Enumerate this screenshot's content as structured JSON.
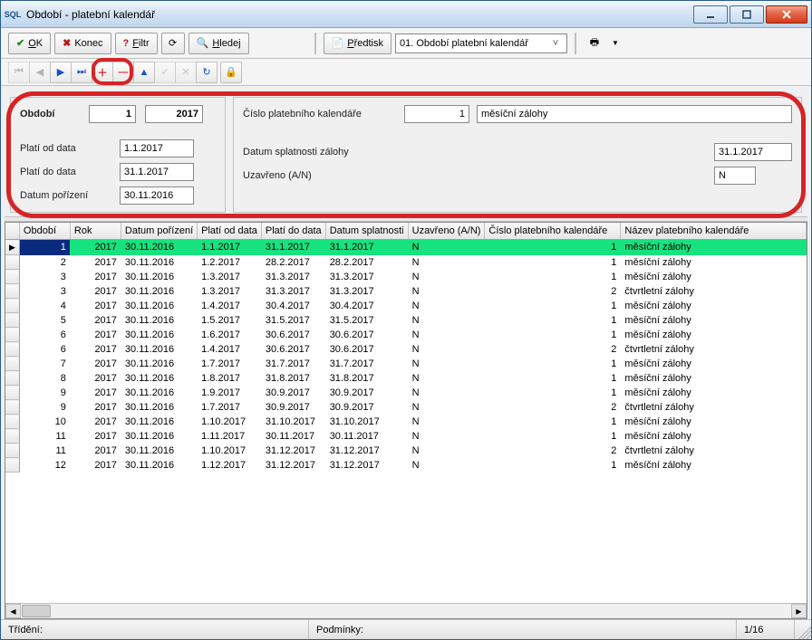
{
  "title": "Období - platební kalendář",
  "toolbar": {
    "ok": "OK",
    "konec": "Konec",
    "filtr": "Filtr",
    "hledej": "Hledej",
    "predtisk": "Předtisk",
    "dropdown_selected": "01. Období platební kalendář"
  },
  "form": {
    "period_label": "Období",
    "period_no": "1",
    "period_year": "2017",
    "plati_od_label": "Platí od data",
    "plati_od": "1.1.2017",
    "plati_do_label": "Platí do data",
    "plati_do": "31.1.2017",
    "datum_porizeni_label": "Datum pořízení",
    "datum_porizeni": "30.11.2016",
    "cislo_label": "Číslo platebního kalendáře",
    "cislo": "1",
    "nazev": "měsíční zálohy",
    "splatnost_label": "Datum splatnosti zálohy",
    "splatnost": "31.1.2017",
    "uzavreno_label": "Uzavřeno (A/N)",
    "uzavreno": "N"
  },
  "grid": {
    "headers": {
      "obdobi": "Období",
      "rok": "Rok",
      "datum_porizeni": "Datum pořízení",
      "plati_od": "Platí od data",
      "plati_do": "Platí do data",
      "splatnost": "Datum splatnosti",
      "uzavreno": "Uzavřeno (A/N)",
      "cislo": "Číslo platebního kalendáře",
      "nazev": "Název platebního kalendáře"
    },
    "rows": [
      {
        "sel": true,
        "obdobi": "1",
        "rok": "2017",
        "dp": "30.11.2016",
        "od": "1.1.2017",
        "do": "31.1.2017",
        "sp": "31.1.2017",
        "uz": "N",
        "c": "1",
        "nz": "měsíční zálohy"
      },
      {
        "sel": false,
        "obdobi": "2",
        "rok": "2017",
        "dp": "30.11.2016",
        "od": "1.2.2017",
        "do": "28.2.2017",
        "sp": "28.2.2017",
        "uz": "N",
        "c": "1",
        "nz": "měsíční zálohy"
      },
      {
        "sel": false,
        "obdobi": "3",
        "rok": "2017",
        "dp": "30.11.2016",
        "od": "1.3.2017",
        "do": "31.3.2017",
        "sp": "31.3.2017",
        "uz": "N",
        "c": "1",
        "nz": "měsíční zálohy"
      },
      {
        "sel": false,
        "obdobi": "3",
        "rok": "2017",
        "dp": "30.11.2016",
        "od": "1.3.2017",
        "do": "31.3.2017",
        "sp": "31.3.2017",
        "uz": "N",
        "c": "2",
        "nz": "čtvrtletní zálohy"
      },
      {
        "sel": false,
        "obdobi": "4",
        "rok": "2017",
        "dp": "30.11.2016",
        "od": "1.4.2017",
        "do": "30.4.2017",
        "sp": "30.4.2017",
        "uz": "N",
        "c": "1",
        "nz": "měsíční zálohy"
      },
      {
        "sel": false,
        "obdobi": "5",
        "rok": "2017",
        "dp": "30.11.2016",
        "od": "1.5.2017",
        "do": "31.5.2017",
        "sp": "31.5.2017",
        "uz": "N",
        "c": "1",
        "nz": "měsíční zálohy"
      },
      {
        "sel": false,
        "obdobi": "6",
        "rok": "2017",
        "dp": "30.11.2016",
        "od": "1.6.2017",
        "do": "30.6.2017",
        "sp": "30.6.2017",
        "uz": "N",
        "c": "1",
        "nz": "měsíční zálohy"
      },
      {
        "sel": false,
        "obdobi": "6",
        "rok": "2017",
        "dp": "30.11.2016",
        "od": "1.4.2017",
        "do": "30.6.2017",
        "sp": "30.6.2017",
        "uz": "N",
        "c": "2",
        "nz": "čtvrtletní zálohy"
      },
      {
        "sel": false,
        "obdobi": "7",
        "rok": "2017",
        "dp": "30.11.2016",
        "od": "1.7.2017",
        "do": "31.7.2017",
        "sp": "31.7.2017",
        "uz": "N",
        "c": "1",
        "nz": "měsíční zálohy"
      },
      {
        "sel": false,
        "obdobi": "8",
        "rok": "2017",
        "dp": "30.11.2016",
        "od": "1.8.2017",
        "do": "31.8.2017",
        "sp": "31.8.2017",
        "uz": "N",
        "c": "1",
        "nz": "měsíční zálohy"
      },
      {
        "sel": false,
        "obdobi": "9",
        "rok": "2017",
        "dp": "30.11.2016",
        "od": "1.9.2017",
        "do": "30.9.2017",
        "sp": "30.9.2017",
        "uz": "N",
        "c": "1",
        "nz": "měsíční zálohy"
      },
      {
        "sel": false,
        "obdobi": "9",
        "rok": "2017",
        "dp": "30.11.2016",
        "od": "1.7.2017",
        "do": "30.9.2017",
        "sp": "30.9.2017",
        "uz": "N",
        "c": "2",
        "nz": "čtvrtletní zálohy"
      },
      {
        "sel": false,
        "obdobi": "10",
        "rok": "2017",
        "dp": "30.11.2016",
        "od": "1.10.2017",
        "do": "31.10.2017",
        "sp": "31.10.2017",
        "uz": "N",
        "c": "1",
        "nz": "měsíční zálohy"
      },
      {
        "sel": false,
        "obdobi": "11",
        "rok": "2017",
        "dp": "30.11.2016",
        "od": "1.11.2017",
        "do": "30.11.2017",
        "sp": "30.11.2017",
        "uz": "N",
        "c": "1",
        "nz": "měsíční zálohy"
      },
      {
        "sel": false,
        "obdobi": "11",
        "rok": "2017",
        "dp": "30.11.2016",
        "od": "1.10.2017",
        "do": "31.12.2017",
        "sp": "31.12.2017",
        "uz": "N",
        "c": "2",
        "nz": "čtvrtletní zálohy"
      },
      {
        "sel": false,
        "obdobi": "12",
        "rok": "2017",
        "dp": "30.11.2016",
        "od": "1.12.2017",
        "do": "31.12.2017",
        "sp": "31.12.2017",
        "uz": "N",
        "c": "1",
        "nz": "měsíční zálohy"
      }
    ]
  },
  "status": {
    "trideni": "Třídění:",
    "podminky": "Podmínky:",
    "count": "1/16"
  }
}
